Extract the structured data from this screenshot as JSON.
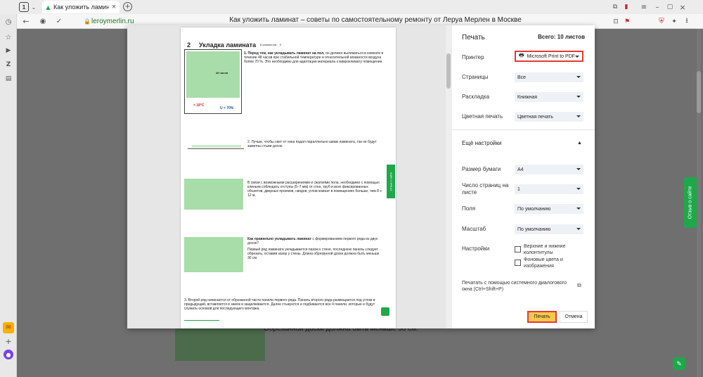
{
  "browser": {
    "tab_badge": "1",
    "tab_title": "Как уложить ламинат",
    "url": "leroymerlin.ru",
    "page_title": "Как уложить ламинат – советы по самостоятельному ремонту от Леруа Мерлен в Москве"
  },
  "background_page": {
    "visible_text": "Обрезанной доски должна быть меньше 30 см.",
    "feedback_tab": "Отзыв о сайте"
  },
  "preview": {
    "section_number": "2",
    "section_title": "Укладка ламината",
    "meta": "8 комментов",
    "meta_count": "0",
    "paragraph_1_lead": "1. Перед тем, как укладывать ламинат на пол,",
    "paragraph_1": "он должен вылежаться в комнате в течение 48 часов при стабильной температуре и относительной влажности воздуха более 70 %. Это необходимо для адаптации материала к микроклимату помещения.",
    "hours_label": "48 часов",
    "temp": "> 18°C",
    "humidity": "U < 70%",
    "paragraph_2": "2. Лучше, чтобы свет от окна падал параллельно швам ламината, так не будут заметны стыки досок.",
    "paragraph_3": "В связи с возможными расширениями и сжатиями пола, необходимо с помощью клиньев соблюдать отступы (5–7 мм) от стен, труб и всех фиксированных объектов, дверных проемов, сводов, углов комнат в помещениях больше, чем 8 х 12 м.",
    "paragraph_4_lead": "Как правильно укладывать ламинат",
    "paragraph_4_rest": "с формированием первого ряда из двух досок?",
    "paragraph_5": "Первый ряд ламината укладывается пазом к стене, последнюю панель следует обрезать, оставив зазор у стены. Длина обрезанной доски должна быть меньше 30 см.",
    "paragraph_6": "3. Второй ряд начинается от обрезанной части панели первого ряда. Панель второго ряда размещается под углом в предыдущий, вставляется в замок и защелкивается. Далее стыкуются и подбиваются все 4 панели, которые и будут служить основой для последующего монтажа.",
    "side_tab": "Отзыв о сайте"
  },
  "settings": {
    "title": "Печать",
    "total": "Всего: 10 листов",
    "printer_label": "Принтер",
    "printer_value": "Microsoft Print to PDF",
    "pages_label": "Страницы",
    "pages_value": "Все",
    "layout_label": "Раскладка",
    "layout_value": "Книжная",
    "color_label": "Цветная печать",
    "color_value": "Цветная печать",
    "more_label": "Ещё настройки",
    "paper_label": "Размер бумаги",
    "paper_value": "A4",
    "pps_label": "Число страниц на листе",
    "pps_value": "1",
    "margins_label": "Поля",
    "margins_value": "По умолчанию",
    "scale_label": "Масштаб",
    "scale_value": "По умолчанию",
    "options_label": "Настройки",
    "option_headers": "Верхние и нижние колонтитулы",
    "option_background": "Фоновые цвета и изображения",
    "system_dialog": "Печатать с помощью системного диалогового окна (Ctrl+Shift+P)",
    "print_button": "Печать",
    "cancel_button": "Отмена"
  },
  "colors": {
    "accent_green": "#1ea84a",
    "highlight_red": "#e53935",
    "print_button_yellow": "#f5c84b"
  }
}
